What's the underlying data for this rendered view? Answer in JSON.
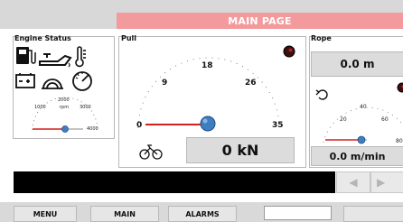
{
  "header": {
    "title": "MAIN PAGE"
  },
  "engine": {
    "title": "Engine Status",
    "gauge": {
      "min_label": "1000",
      "mid_label": "2000",
      "max_label": "3000",
      "unit": "rpm",
      "far_label": "4000",
      "value_fraction": 0.7
    }
  },
  "pull": {
    "title": "Pull",
    "ticks": [
      "0",
      "9",
      "18",
      "26",
      "35"
    ],
    "readout": "0 kN",
    "value_fraction": 0.84
  },
  "rope": {
    "title": "Rope",
    "length": "0.0 m",
    "ticks": [
      "20",
      "40",
      "60",
      "80"
    ],
    "speed": "0.0 m/min",
    "value_fraction": 0.55
  },
  "nav": {
    "menu": "MENU",
    "main": "MAIN",
    "alarms": "ALARMS",
    "scroll_left": "◀",
    "scroll_right": "▶"
  },
  "colors": {
    "header_band": "#f29a9c",
    "needle_red": "#d51e1e",
    "knob_blue": "#3f7fc0"
  }
}
